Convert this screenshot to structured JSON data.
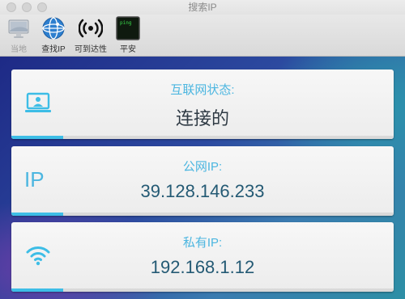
{
  "window": {
    "title": "搜索IP"
  },
  "toolbar": {
    "items": [
      {
        "label": "当地",
        "icon": "computer-icon",
        "enabled": false
      },
      {
        "label": "查找IP",
        "icon": "globe-icon",
        "enabled": true
      },
      {
        "label": "可到达性",
        "icon": "signal-icon",
        "enabled": true
      },
      {
        "label": "平安",
        "icon": "terminal-ping-icon",
        "enabled": true
      }
    ],
    "ping_screen_text": "ping"
  },
  "cards": {
    "internet": {
      "label": "互联网状态:",
      "value": "连接的",
      "icon": "laptop-icon"
    },
    "public": {
      "label": "公网IP:",
      "value": "39.128.146.233",
      "icon_text": "IP"
    },
    "private": {
      "label": "私有IP:",
      "value": "192.168.1.12",
      "icon": "wifi-icon"
    }
  },
  "colors": {
    "accent": "#3dbde6",
    "label": "#4cb6e0",
    "value": "#245a74"
  }
}
